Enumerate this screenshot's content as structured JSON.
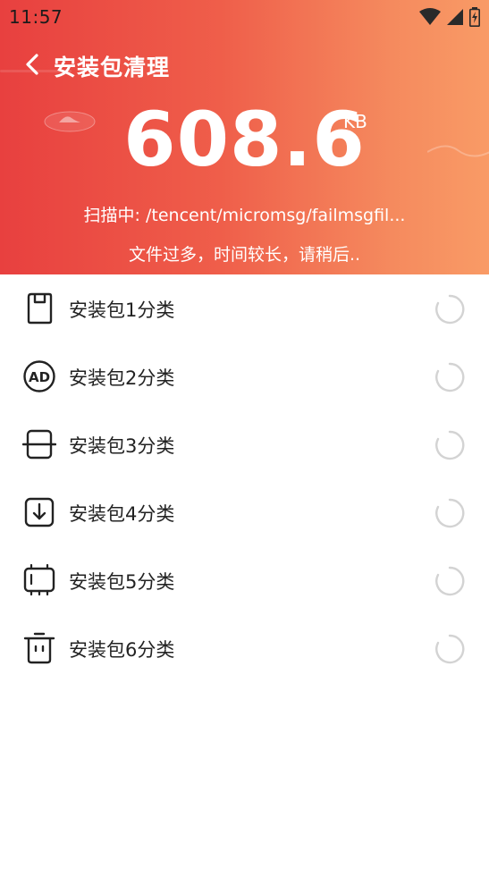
{
  "status_bar": {
    "time": "11:57",
    "icons": [
      "wifi-icon",
      "signal-icon",
      "battery-charging-icon"
    ]
  },
  "header": {
    "title": "安装包清理",
    "size_value": "608.6",
    "size_unit": "KB",
    "scan_prefix": "扫描中:",
    "scan_path": "/tencent/micromsg/failmsgfil...",
    "wait_text": "文件过多，时间较长，请稍后..",
    "gradient": [
      "#e8403f",
      "#f99b66"
    ]
  },
  "categories": [
    {
      "label": "安装包1分类",
      "icon": "sd-card-icon"
    },
    {
      "label": "安装包2分类",
      "icon": "ad-icon"
    },
    {
      "label": "安装包3分类",
      "icon": "crop-frame-icon"
    },
    {
      "label": "安装包4分类",
      "icon": "download-box-icon"
    },
    {
      "label": "安装包5分类",
      "icon": "chip-icon"
    },
    {
      "label": "安装包6分类",
      "icon": "trash-icon"
    }
  ]
}
